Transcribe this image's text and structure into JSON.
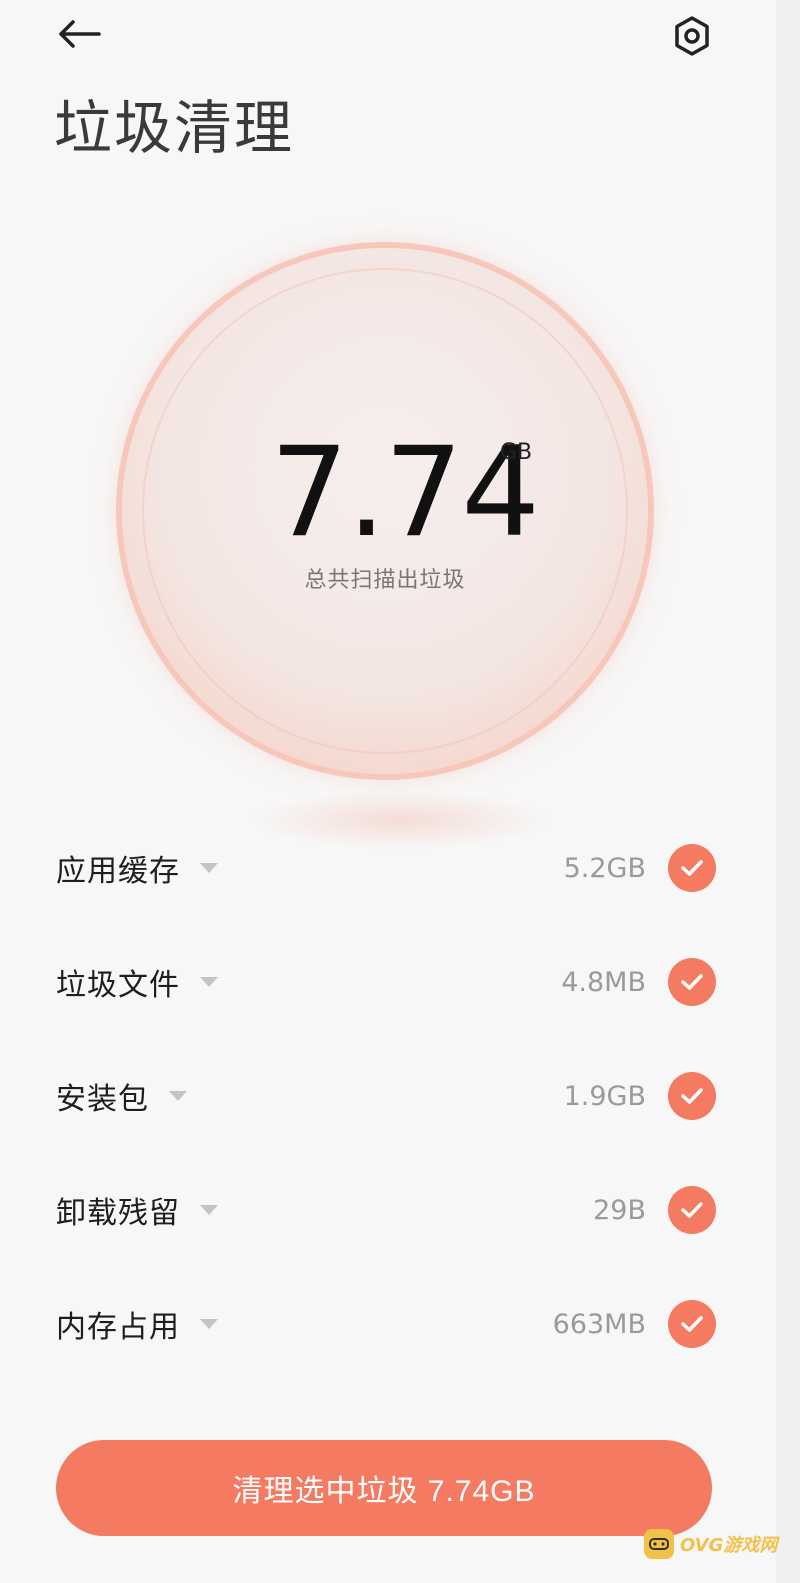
{
  "header": {
    "back_icon": "arrow-left-icon",
    "settings_icon": "hexagon-gear-icon",
    "title": "垃圾清理"
  },
  "summary": {
    "total_value": "7.74",
    "total_unit": "GB",
    "total_label": "总共扫描出垃圾"
  },
  "items": [
    {
      "label": "应用缓存",
      "size": "5.2GB",
      "checked": true
    },
    {
      "label": "垃圾文件",
      "size": "4.8MB",
      "checked": true
    },
    {
      "label": "安装包",
      "size": "1.9GB",
      "checked": true
    },
    {
      "label": "卸载残留",
      "size": "29B",
      "checked": true
    },
    {
      "label": "内存占用",
      "size": "663MB",
      "checked": true
    }
  ],
  "action": {
    "clean_label": "清理选中垃圾 7.74GB"
  },
  "watermark": {
    "text": "OVG游戏网"
  },
  "colors": {
    "accent": "#f47a62",
    "background": "#f7f7f7",
    "secondary_text": "#9a9a9a"
  }
}
